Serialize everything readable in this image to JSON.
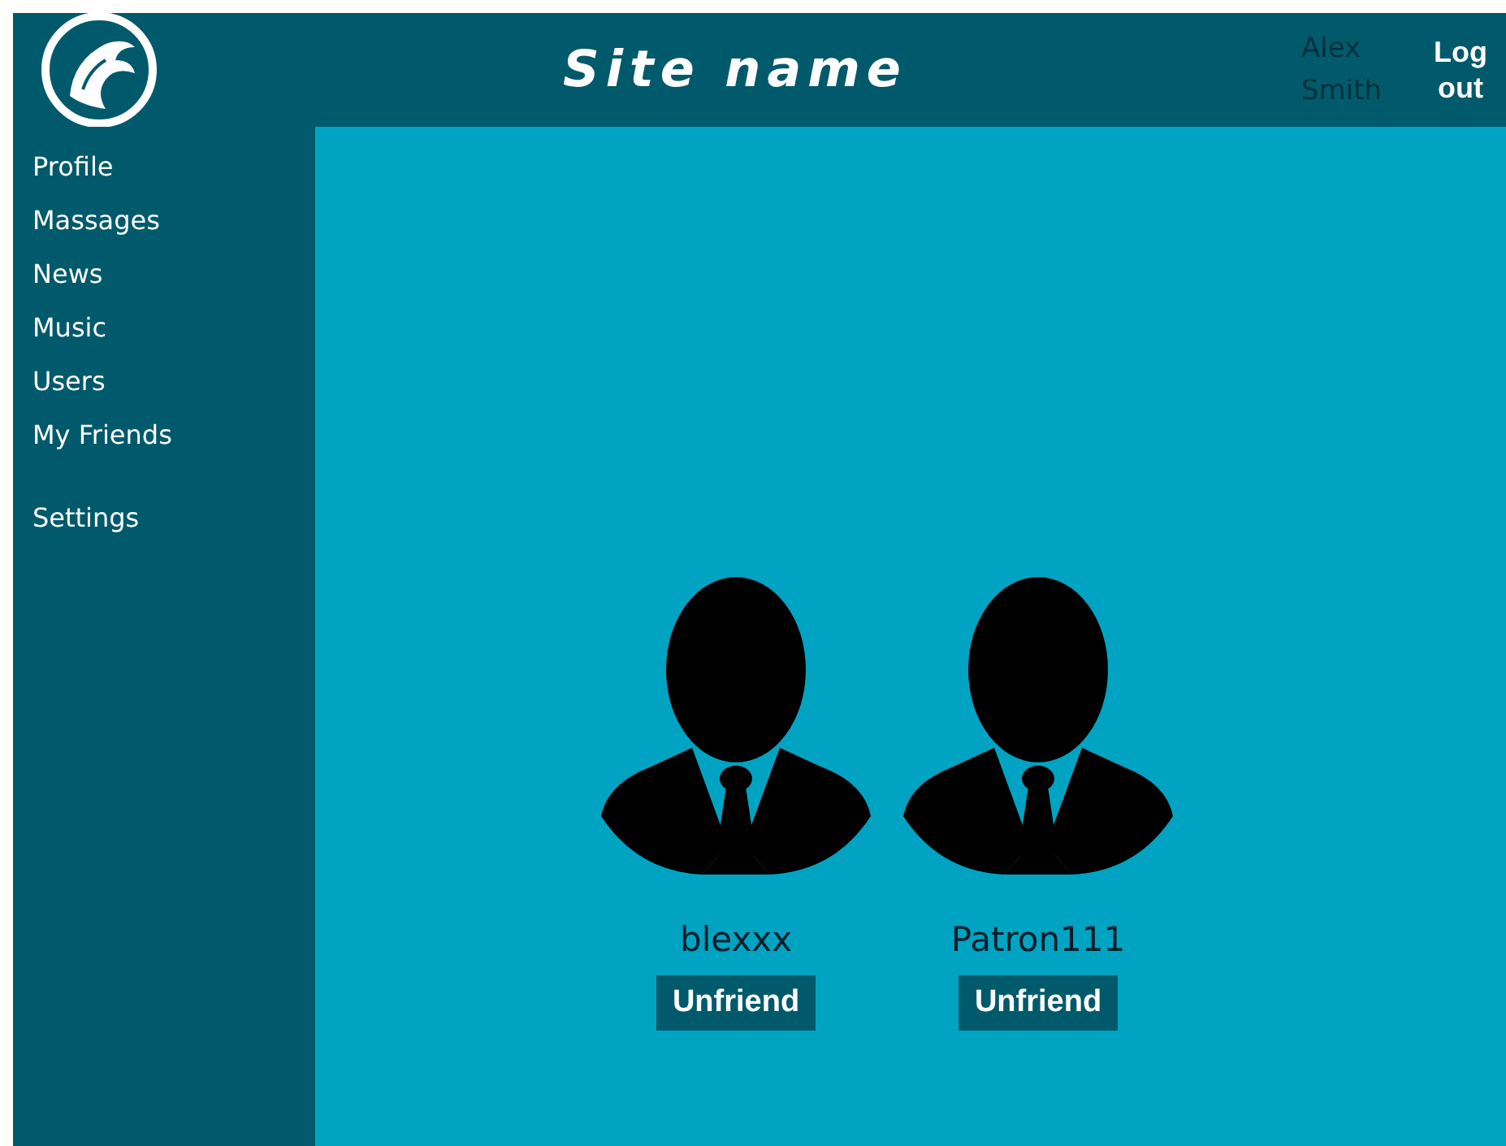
{
  "header": {
    "title": "Site name",
    "user_name": "Alex Smith",
    "logout": "Log out"
  },
  "sidebar": {
    "sections": [
      {
        "items": [
          {
            "label": "Profile"
          },
          {
            "label": "Massages"
          },
          {
            "label": "News"
          },
          {
            "label": "Music"
          },
          {
            "label": "Users"
          },
          {
            "label": "My Friends"
          }
        ]
      },
      {
        "items": [
          {
            "label": "Settings"
          }
        ]
      }
    ]
  },
  "friends": [
    {
      "name": "blexxx",
      "button": "Unfriend"
    },
    {
      "name": "Patron111",
      "button": "Unfriend"
    }
  ]
}
